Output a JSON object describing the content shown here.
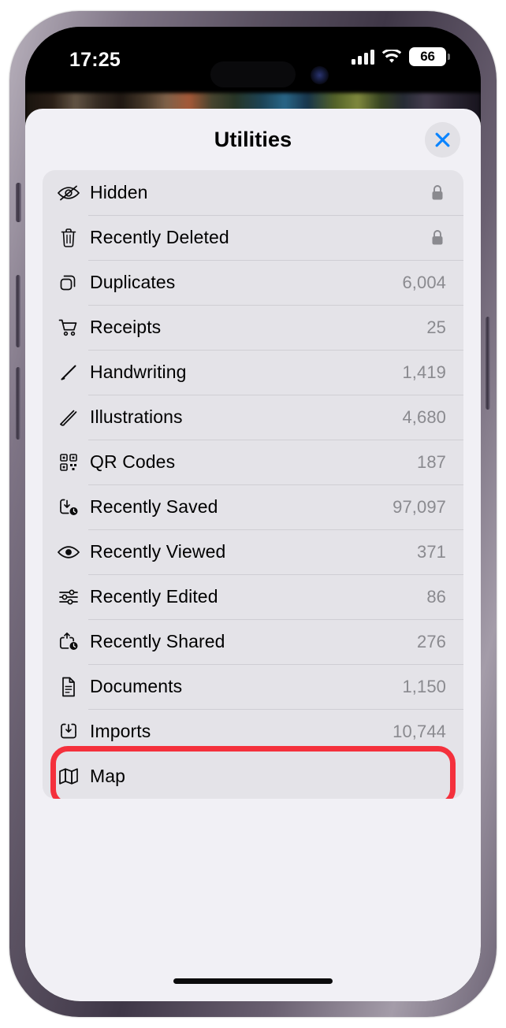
{
  "status_bar": {
    "time": "17:25",
    "battery_percent": "66",
    "signal_icon": "cellular-bars-icon",
    "wifi_icon": "wifi-icon",
    "battery_icon": "battery-icon"
  },
  "sheet": {
    "title": "Utilities",
    "close_icon": "close-icon",
    "close_label": "Close"
  },
  "list": {
    "rows": [
      {
        "icon": "eye-slash-icon",
        "label": "Hidden",
        "count": "",
        "locked": true
      },
      {
        "icon": "trash-icon",
        "label": "Recently Deleted",
        "count": "",
        "locked": true
      },
      {
        "icon": "duplicate-icon",
        "label": "Duplicates",
        "count": "6,004",
        "locked": false
      },
      {
        "icon": "cart-icon",
        "label": "Receipts",
        "count": "25",
        "locked": false
      },
      {
        "icon": "pencil-icon",
        "label": "Handwriting",
        "count": "1,419",
        "locked": false
      },
      {
        "icon": "scribble-icon",
        "label": "Illustrations",
        "count": "4,680",
        "locked": false
      },
      {
        "icon": "qr-code-icon",
        "label": "QR Codes",
        "count": "187",
        "locked": false
      },
      {
        "icon": "tray-download-clock-icon",
        "label": "Recently Saved",
        "count": "97,097",
        "locked": false
      },
      {
        "icon": "eye-icon",
        "label": "Recently Viewed",
        "count": "371",
        "locked": false
      },
      {
        "icon": "sliders-icon",
        "label": "Recently Edited",
        "count": "86",
        "locked": false
      },
      {
        "icon": "share-clock-icon",
        "label": "Recently Shared",
        "count": "276",
        "locked": false
      },
      {
        "icon": "document-icon",
        "label": "Documents",
        "count": "1,150",
        "locked": false
      },
      {
        "icon": "tray-upload-icon",
        "label": "Imports",
        "count": "10,744",
        "locked": false
      },
      {
        "icon": "map-icon",
        "label": "Map",
        "count": "",
        "locked": false
      }
    ],
    "lock_icon": "lock-icon",
    "highlighted_row_label": "Map"
  },
  "annotation": {
    "color": "#F4303C",
    "target": "Map"
  },
  "colors": {
    "sheet_background": "#F1F0F5",
    "list_background": "#E4E3E8",
    "accent_blue": "#0A84FF",
    "count_text": "#8A8A8F",
    "separator": "#CFCED4"
  }
}
